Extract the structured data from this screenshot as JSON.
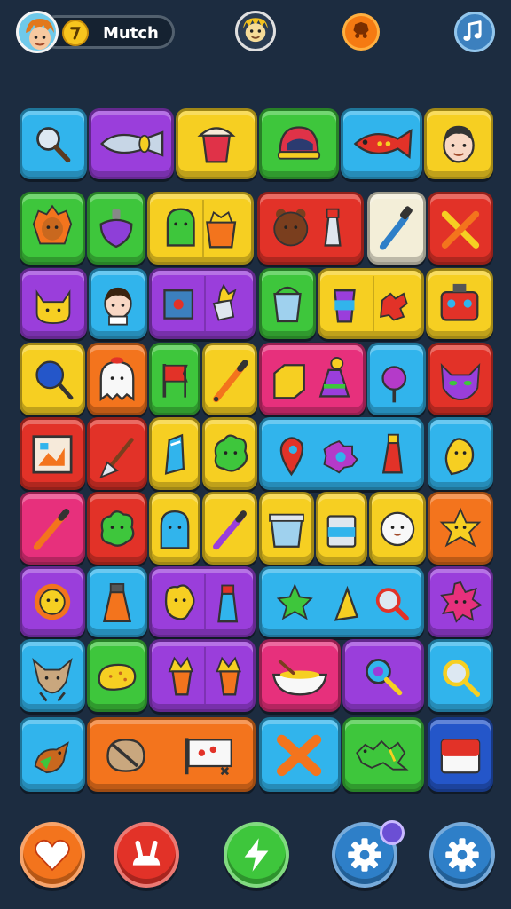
{
  "header": {
    "title": "Mutch",
    "icons": [
      "player-avatar-icon",
      "coin-icon",
      "mascot-icon",
      "bonus-icon",
      "music-icon"
    ]
  },
  "board": {
    "rows": [
      [
        "magnifier",
        "candy",
        "cake",
        "helmet",
        "fish",
        "face"
      ],
      [
        "lion",
        "top",
        "jelly",
        "pot",
        "bear",
        "bottle",
        "dropper",
        "cross"
      ],
      [
        "cat",
        "girl",
        "frame",
        "cone",
        "bucket",
        "cup",
        "puzzle",
        "robot"
      ],
      [
        "lollipop",
        "ghost",
        "flag",
        "pencil",
        "box",
        "flask",
        "lollipop",
        "monster"
      ],
      [
        "picture",
        "arrow",
        "tube",
        "blob",
        "pin",
        "gear",
        "bottle",
        "bean"
      ],
      [
        "pencil",
        "blob",
        "ghost",
        "pencil",
        "bucket",
        "jar",
        "ghost",
        "star"
      ],
      [
        "sun",
        "bottle",
        "gummy",
        "bottle",
        "star",
        "cone",
        "magnifier",
        "spiky"
      ],
      [
        "fox",
        "bread",
        "crown",
        "crown",
        "bowl",
        "magnifier",
        "magnifier"
      ],
      [
        "bird",
        "sack",
        "flag",
        "cross",
        "dragon",
        "block"
      ]
    ]
  },
  "bottom_bar": {
    "buttons": [
      "heart",
      "bunny",
      "lightning",
      "settings",
      "settings"
    ],
    "notification": true
  },
  "colors": {
    "background": "#1c2c40",
    "blue": "#31b4ec",
    "purple": "#9a3edb",
    "yellow": "#f6cf22",
    "green": "#3ec63c",
    "red": "#e23228",
    "orange": "#f3741d",
    "pink": "#e7307c"
  }
}
